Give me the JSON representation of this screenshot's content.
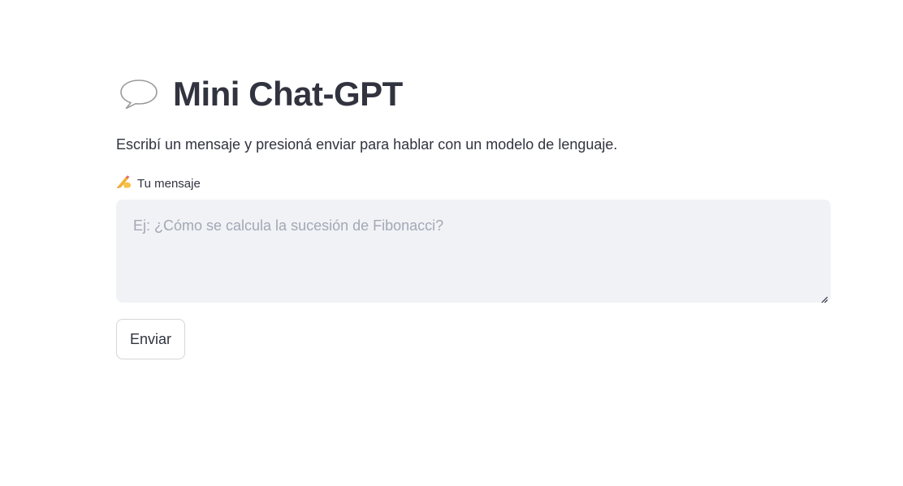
{
  "header": {
    "icon": "speech-balloon-icon",
    "title": "Mini Chat-GPT"
  },
  "intro": {
    "text": "Escribí un mensaje y presioná enviar para hablar con un modelo de lenguaje."
  },
  "message_field": {
    "label_icon": "writing-hand-icon",
    "label": "Tu mensaje",
    "value": "",
    "placeholder": "Ej: ¿Cómo se calcula la sucesión de Fibonacci?"
  },
  "actions": {
    "send_label": "Enviar"
  },
  "colors": {
    "text": "#31333f",
    "input_background": "#f0f2f6",
    "placeholder": "#a3a8b4",
    "button_border": "#d6d6d9"
  }
}
